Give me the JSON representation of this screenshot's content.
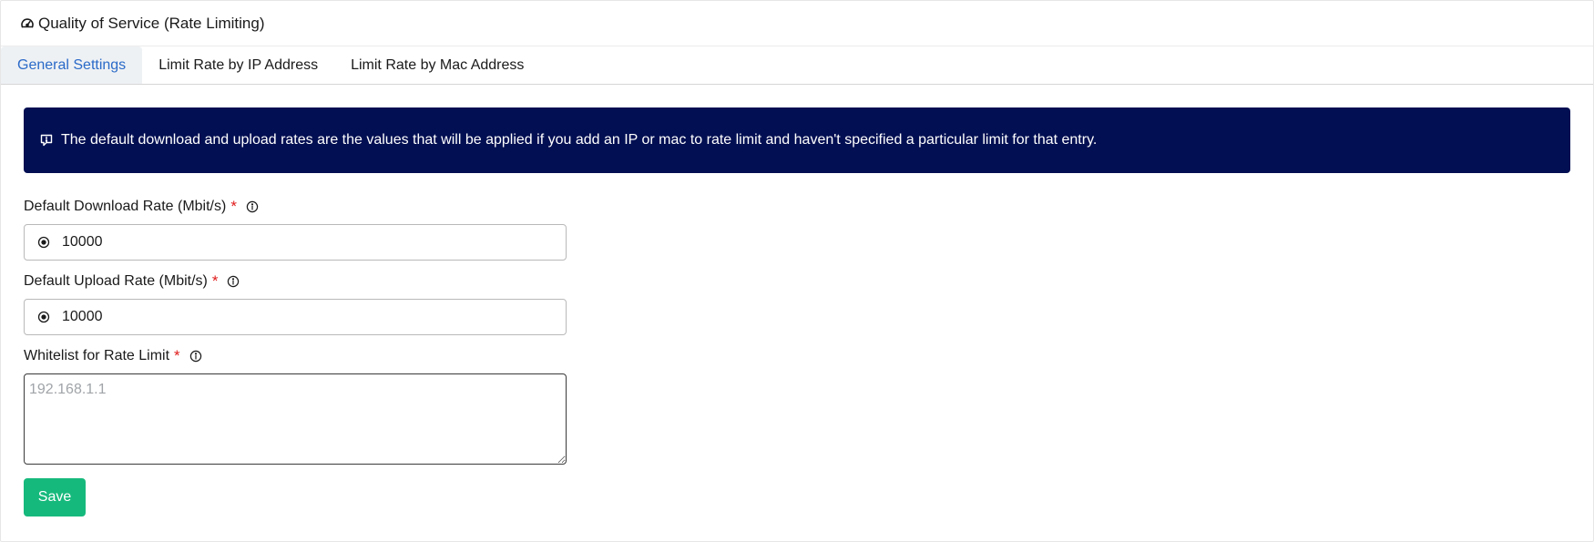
{
  "panel": {
    "title": "Quality of Service (Rate Limiting)",
    "title_icon": "speedometer-icon"
  },
  "tabs": [
    {
      "label": "General Settings",
      "active": true
    },
    {
      "label": "Limit Rate by IP Address",
      "active": false
    },
    {
      "label": "Limit Rate by Mac Address",
      "active": false
    }
  ],
  "info": {
    "icon": "comment-info-icon",
    "text": "The default download and upload rates are the values that will be applied if you add an IP or mac to rate limit and haven't specified a particular limit for that entry.",
    "background": "#020f52"
  },
  "fields": {
    "download": {
      "label": "Default Download Rate (Mbit/s)",
      "required_mark": "*",
      "value": "10000",
      "icon": "radio-target-icon"
    },
    "upload": {
      "label": "Default Upload Rate (Mbit/s)",
      "required_mark": "*",
      "value": "10000",
      "icon": "radio-target-icon"
    },
    "whitelist": {
      "label": "Whitelist for Rate Limit",
      "required_mark": "*",
      "value": "",
      "placeholder": "192.168.1.1"
    }
  },
  "actions": {
    "save_label": "Save",
    "save_color": "#16b97c"
  },
  "colors": {
    "active_tab": "#2a6ac8",
    "required": "#e01b1b"
  }
}
